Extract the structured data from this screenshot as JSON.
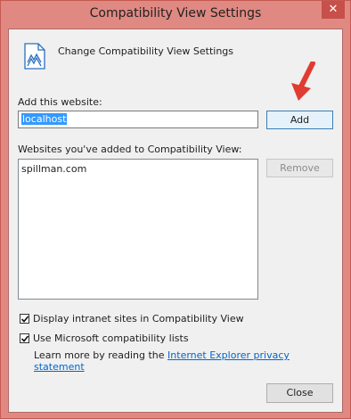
{
  "window": {
    "title": "Compatibility View Settings",
    "close_glyph": "✕"
  },
  "header": {
    "text": "Change Compatibility View Settings",
    "icon": "compat-view-icon"
  },
  "add_site": {
    "label": "Add this website:",
    "value": "localhost",
    "add_button": "Add"
  },
  "list": {
    "label": "Websites you've added to Compatibility View:",
    "items": [
      "spillman.com"
    ],
    "remove_button": "Remove"
  },
  "options": {
    "intranet": {
      "label": "Display intranet sites in Compatibility View",
      "checked": true
    },
    "ms_lists": {
      "label": "Use Microsoft compatibility lists",
      "checked": true
    }
  },
  "learn_more": {
    "prefix": "Learn more by reading the ",
    "link": "Internet Explorer privacy statement"
  },
  "footer": {
    "close_button": "Close"
  },
  "colors": {
    "frame": "#e08982",
    "accent_arrow": "#e03c31",
    "link": "#0066cc"
  }
}
